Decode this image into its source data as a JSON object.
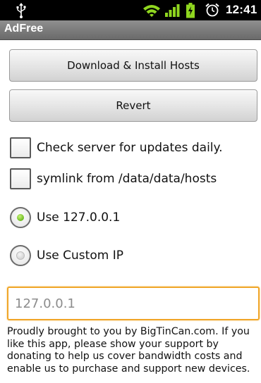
{
  "status_bar": {
    "time": "12:41",
    "icons": [
      "usb-icon",
      "wifi-icon",
      "signal-icon",
      "battery-icon",
      "alarm-icon"
    ],
    "accent_color": "#8fd61f"
  },
  "app": {
    "title": "AdFree"
  },
  "actions": {
    "download_label": "Download & Install Hosts",
    "revert_label": "Revert"
  },
  "options": {
    "check_updates_label": "Check server for updates daily.",
    "check_updates_checked": false,
    "symlink_label": "symlink from /data/data/hosts",
    "symlink_checked": false
  },
  "ip_mode": {
    "localhost_label": "Use 127.0.0.1",
    "custom_label": "Use Custom IP",
    "selected": "localhost"
  },
  "custom_ip": {
    "value": "",
    "placeholder": "127.0.0.1",
    "focus_color": "#f0a629"
  },
  "footer": {
    "text": "Proudly brought to you by BigTinCan.com. If you like this app, please show your support by donating to help us cover bandwidth costs and enable us to purchase and support new devices."
  }
}
